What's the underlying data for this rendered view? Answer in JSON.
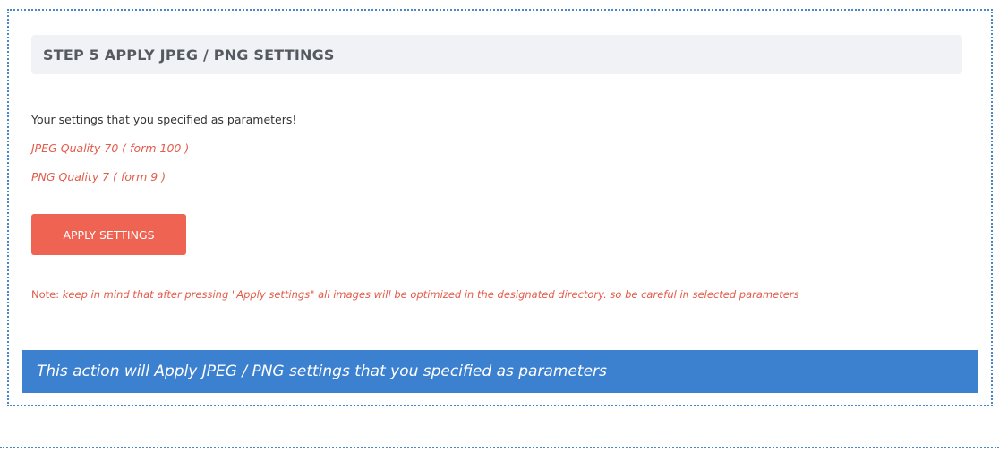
{
  "step": {
    "title": "STEP 5 APPLY JPEG / PNG SETTINGS"
  },
  "settings": {
    "intro": "Your settings that you specified as parameters!",
    "jpeg_quality": "JPEG Quality 70 ( form 100 )",
    "png_quality": "PNG Quality 7 ( form 9 )"
  },
  "actions": {
    "apply_label": "APPLY SETTINGS"
  },
  "note": {
    "label": "Note:",
    "text": "keep in mind that after pressing \"Apply settings\" all images will be optimized in the designated directory. so be careful in selected parameters"
  },
  "banner": {
    "text": "This action will Apply JPEG / PNG settings that you specified as parameters"
  },
  "colors": {
    "accent": "#ee6352",
    "banner": "#3c80d0",
    "border": "#4a86c8",
    "header_bg": "#f1f2f6"
  }
}
